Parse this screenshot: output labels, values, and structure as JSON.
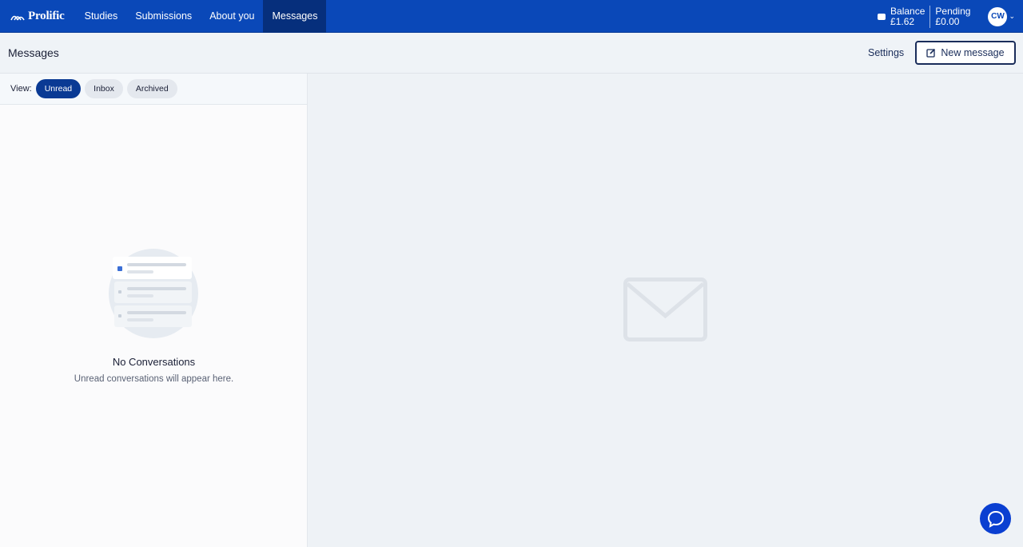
{
  "brand": {
    "name": "Prolific"
  },
  "nav": {
    "items": [
      {
        "label": "Studies"
      },
      {
        "label": "Submissions"
      },
      {
        "label": "About you"
      },
      {
        "label": "Messages"
      }
    ],
    "active_index": 3
  },
  "account": {
    "balance_label": "Balance",
    "balance_value": "£1.62",
    "pending_label": "Pending",
    "pending_value": "£0.00",
    "avatar_initials": "CW"
  },
  "subheader": {
    "title": "Messages",
    "settings_label": "Settings",
    "new_message_label": "New message"
  },
  "view_filter": {
    "label": "View:",
    "options": [
      "Unread",
      "Inbox",
      "Archived"
    ],
    "selected": "Unread"
  },
  "empty_state": {
    "title": "No Conversations",
    "subtitle": "Unread conversations will appear here."
  },
  "colors": {
    "nav_bg": "#0a48b8",
    "nav_active": "#062f7c",
    "pill_active": "#0a3a94",
    "chat_bubble": "#0a3fd1"
  }
}
